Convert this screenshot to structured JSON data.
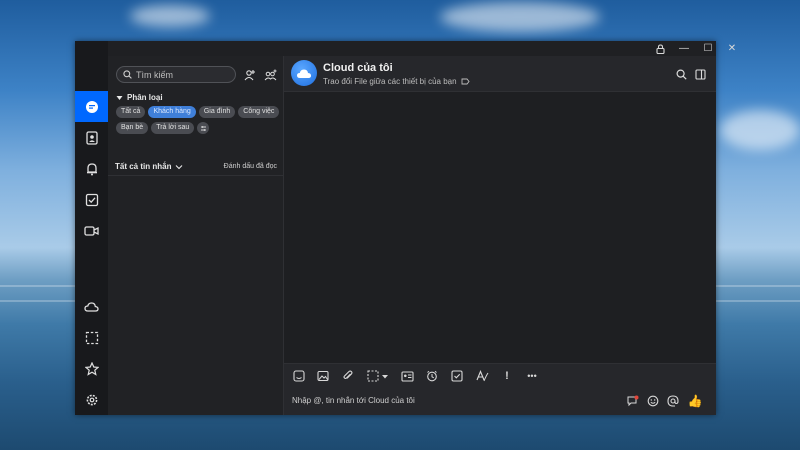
{
  "colors": {
    "accent": "#0068ff",
    "window_bg": "#26272b",
    "chip_selected": "#3f7fd9"
  },
  "window_controls": {
    "lock_icon": "lock-icon",
    "minimize": "—",
    "maximize": "☐",
    "close": "✕"
  },
  "nav_rail": {
    "items": [
      {
        "name": "messages",
        "icon": "chat-bubble-icon",
        "active": true
      },
      {
        "name": "contacts",
        "icon": "contact-book-icon"
      },
      {
        "name": "notifications",
        "icon": "bell-icon"
      },
      {
        "name": "todo",
        "icon": "checkbox-icon"
      },
      {
        "name": "video-call",
        "icon": "video-icon"
      },
      {
        "name": "cloud",
        "icon": "cloud-icon"
      },
      {
        "name": "screenshot",
        "icon": "dashed-square-icon"
      },
      {
        "name": "favorites",
        "icon": "star-icon"
      },
      {
        "name": "settings",
        "icon": "gear-icon"
      }
    ]
  },
  "sidebar": {
    "search_placeholder": "Tìm kiếm",
    "section_label": "Phân loại",
    "chips": [
      "Tất cả",
      "Khách hàng",
      "Gia đình",
      "Công việc",
      "Bạn bè",
      "Trả lời sau"
    ],
    "selected_chip": "Khách hàng",
    "all_messages_label": "Tất cả tin nhắn",
    "mark_read_label": "Đánh dấu đã đọc"
  },
  "chat": {
    "title": "Cloud của tôi",
    "subtitle": "Trao đổi File giữa các thiết bị của bạn",
    "toolbar_icons": [
      "sticker-icon",
      "image-icon",
      "paperclip-icon",
      "screenshot-icon",
      "contact-card-icon",
      "alarm-icon",
      "task-icon",
      "text-format-icon",
      "important-icon",
      "more-icon"
    ],
    "toolbar_important": "!",
    "toolbar_more": "•••",
    "input_placeholder": "Nhập @, tin nhắn tới Cloud của tôi",
    "like_emoji": "👍"
  }
}
